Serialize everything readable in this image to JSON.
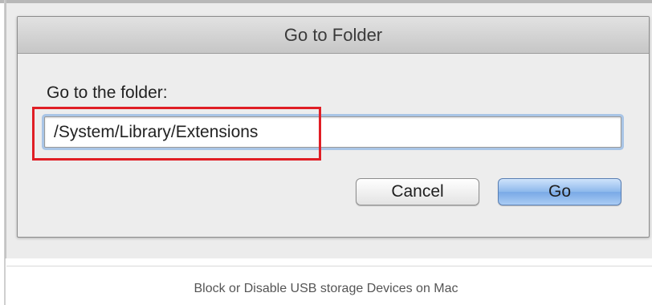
{
  "dialog": {
    "title": "Go to Folder",
    "folder_label": "Go to the folder:",
    "path_value": "/System/Library/Extensions",
    "cancel_label": "Cancel",
    "go_label": "Go",
    "highlight_color": "#e01e25",
    "focus_ring_color": "#a9c5e6",
    "default_button_color": "#79a9e6"
  },
  "caption": {
    "text": "Block or Disable USB storage Devices on Mac"
  }
}
